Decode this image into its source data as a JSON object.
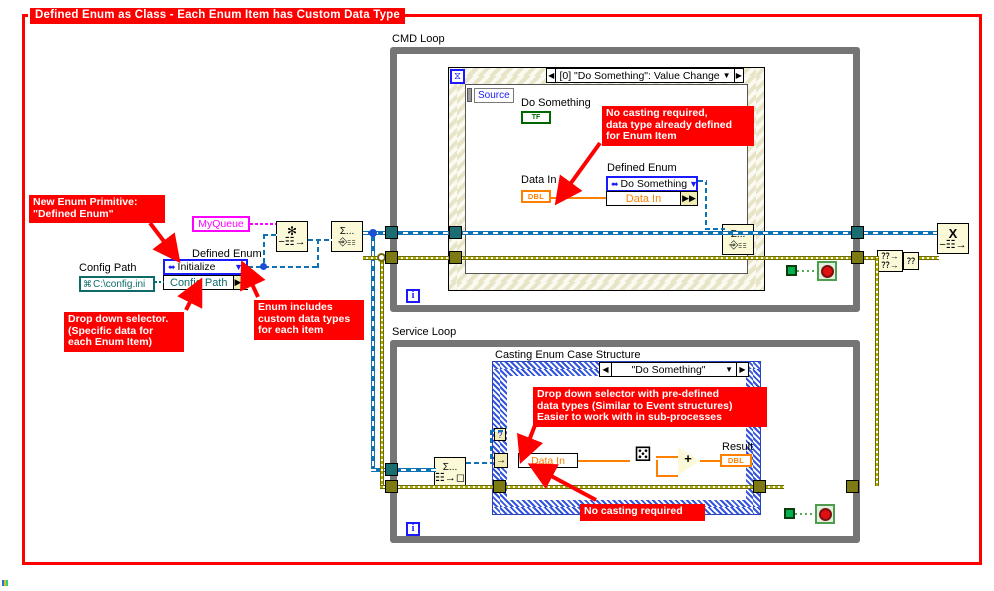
{
  "diagram": {
    "title": "Defined Enum as Class - Each Enum Item has Custom Data Type",
    "accent_color": "#ff0000",
    "background": "#ffffff"
  },
  "callouts": [
    {
      "id": "new-enum-primitive",
      "text": "New Enum Primitive:\n\"Defined Enum\""
    },
    {
      "id": "drop-down-selector",
      "text": "Drop down selector.\n(Specific data for\neach Enum Item)"
    },
    {
      "id": "enum-custom-types",
      "text": "Enum includes\ncustom data types\nfor each item"
    },
    {
      "id": "no-casting-required-cmd",
      "text": "No casting required,\ndata type already defined\nfor Enum Item"
    },
    {
      "id": "drop-down-predefined",
      "text": "Drop down selector with pre-defined\ndata types (Similar to Event structures)\nEasier to work with in sub-processes"
    },
    {
      "id": "no-casting-required-service",
      "text": "No casting required"
    }
  ],
  "loops": {
    "cmd": {
      "label": "CMD Loop",
      "iteration_terminal": "i"
    },
    "service": {
      "label": "Service Loop",
      "iteration_terminal": "i"
    }
  },
  "structures": {
    "event": {
      "case_label": "[0] \"Do Something\": Value Change",
      "left_arrow": "◀",
      "right_arrow": "▶",
      "caret": "▼",
      "hourglass_icon": "⧖",
      "source_label": "Source"
    },
    "case": {
      "title": "Casting Enum Case Structure",
      "case_label": "\"Do Something\"",
      "left_arrow": "◀",
      "right_arrow": "▶",
      "caret": "▼"
    }
  },
  "terminals": {
    "config_path_label": "Config Path",
    "config_path_value": "C:\\config.ini",
    "config_path_icon": "⌘",
    "queue_ref": "MyQueue",
    "defined_enum_label_left": "Defined Enum",
    "defined_enum_value_left": "Initialize",
    "defined_enum_data_left": "Config Path",
    "defined_enum_label_event": "Defined Enum",
    "defined_enum_value_event": "Do Something",
    "defined_enum_data_event": "Data In",
    "do_something_label": "Do Something",
    "do_something_value": "TF",
    "data_in_label_event": "Data In",
    "data_in_type_event": "DBL",
    "data_in_case": "Data In",
    "result_label": "Result",
    "result_type": "DBL",
    "enum_glyph": "⬌",
    "enum_caret": "▼",
    "plug_glyph": "▶▶",
    "in_arrow": "→"
  },
  "vis": {
    "obtain_queue": "Obtain Queue",
    "enqueue_element_top": "Enqueue Element",
    "enqueue_element_cmd": "Enqueue Element",
    "dequeue_element": "Dequeue Element",
    "release_queue": "Release Queue",
    "compound_or": "Compound Arithmetic (OR)",
    "random_number": "Random Number (0-1)",
    "add": "Add"
  },
  "icon_glyphs": {
    "obtain_queue": "✻",
    "enqueue": "Σ...",
    "dequeue": "Σ...",
    "release_queue": "X",
    "stop_button": "stop-button",
    "random_dice": "⚄",
    "add_operator": "+"
  },
  "colors": {
    "wire_queue_refnum": "#0e72b5",
    "wire_error": "#b0ad00",
    "wire_numeric": "#ff8000",
    "wire_boolean": "#5aa85a",
    "enum_border": "#1a1aff",
    "string_control": "#0e6b6b",
    "queue_name": "#ff00ff",
    "loop_border": "#757575",
    "node_fill": "#fbf9d8"
  }
}
